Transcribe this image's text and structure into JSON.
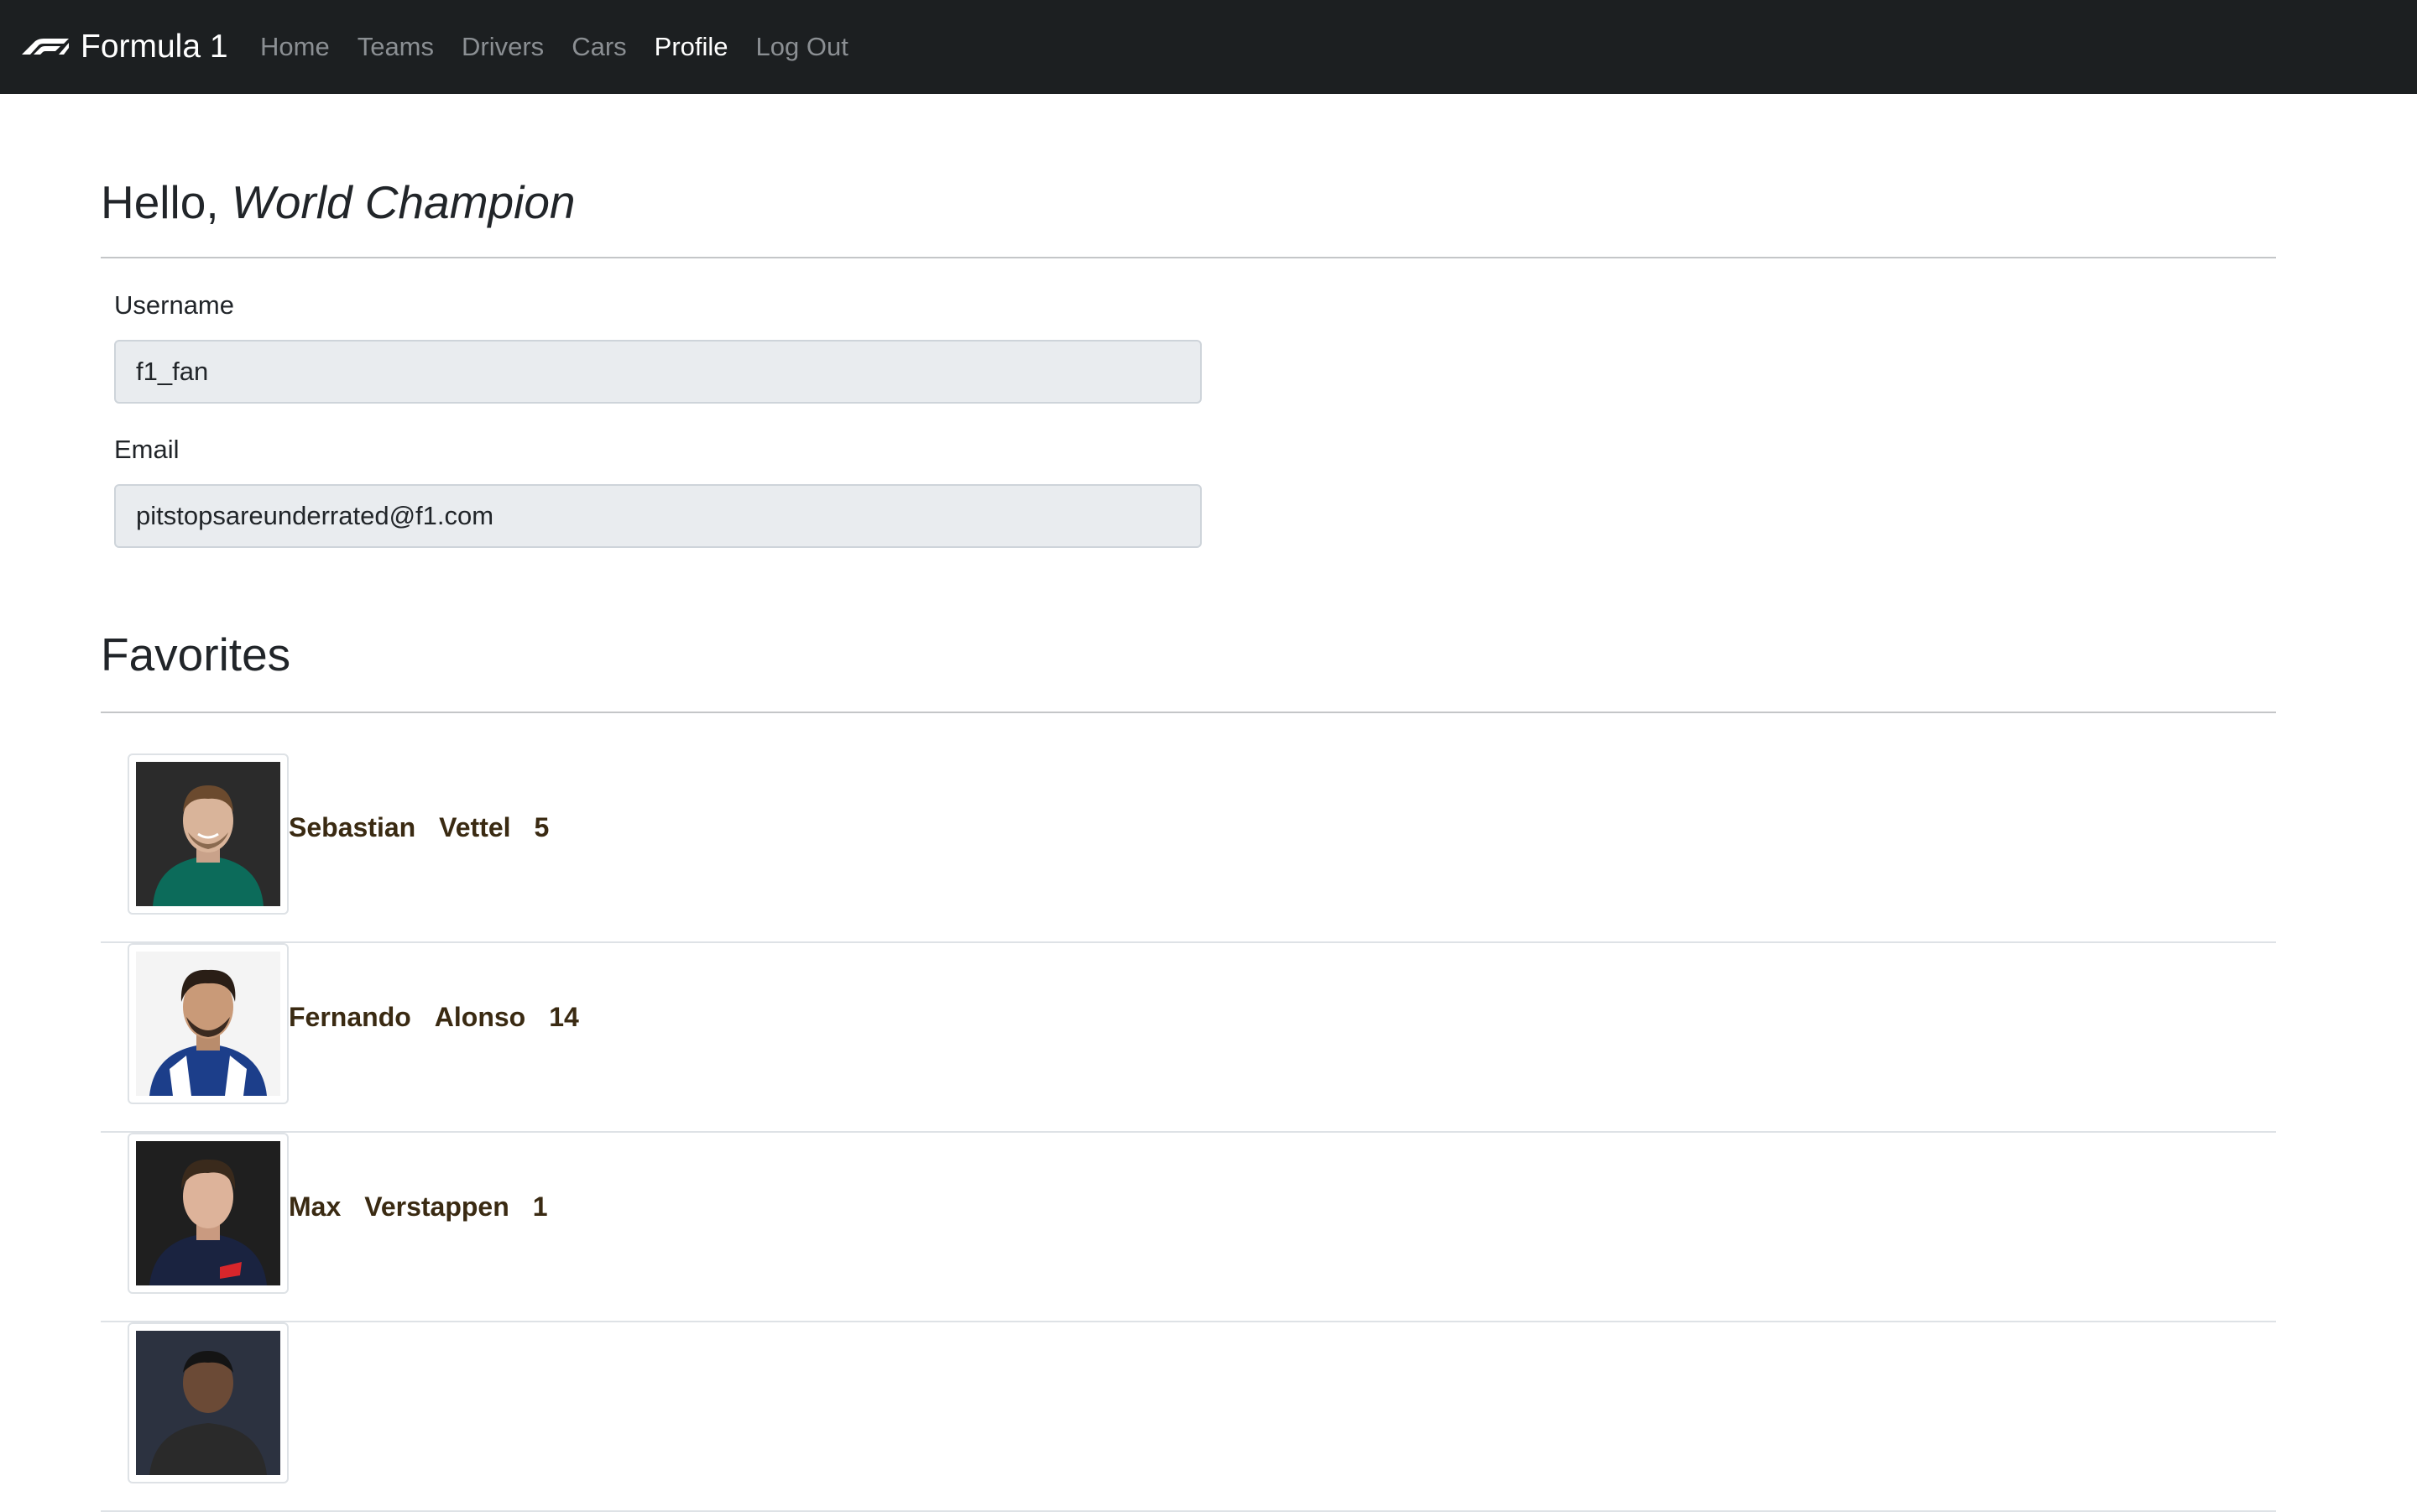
{
  "navbar": {
    "brand": "Formula 1",
    "links": [
      {
        "label": "Home",
        "active": false
      },
      {
        "label": "Teams",
        "active": false
      },
      {
        "label": "Drivers",
        "active": false
      },
      {
        "label": "Cars",
        "active": false
      },
      {
        "label": "Profile",
        "active": true
      },
      {
        "label": "Log Out",
        "active": false
      }
    ],
    "background_color": "#1c1f21"
  },
  "profile": {
    "greeting_prefix": "Hello,",
    "greeting_name": "World Champion",
    "username_label": "Username",
    "username_value": "f1_fan",
    "email_label": "Email",
    "email_value": "pitstopsareunderrated@f1.com"
  },
  "favorites": {
    "title": "Favorites",
    "drivers": [
      {
        "first_name": "Sebastian",
        "last_name": "Vettel",
        "number": "5",
        "suit_color": "#0c6b5a",
        "bg_color": "#2b2b2b"
      },
      {
        "first_name": "Fernando",
        "last_name": "Alonso",
        "number": "14",
        "suit_color": "#1c3e8a",
        "bg_color": "#f4f4f4"
      },
      {
        "first_name": "Max",
        "last_name": "Verstappen",
        "number": "1",
        "suit_color": "#1a2340",
        "bg_color": "#1f1f1f"
      },
      {
        "first_name": "",
        "last_name": "",
        "number": "",
        "suit_color": "#2a2a2a",
        "bg_color": "#2c3240"
      }
    ]
  }
}
